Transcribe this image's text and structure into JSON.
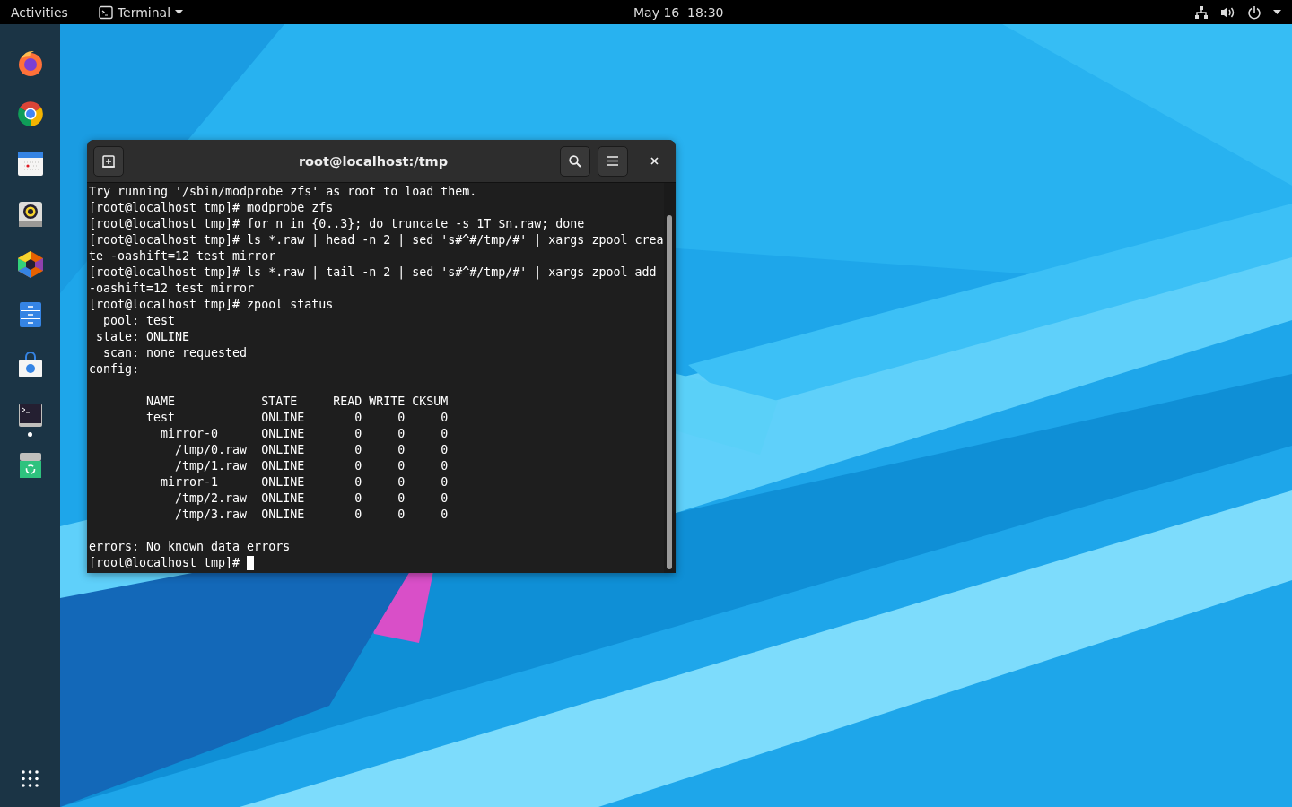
{
  "top_bar": {
    "activities": "Activities",
    "app_menu": "Terminal",
    "clock": "May 16  18:30"
  },
  "dock": {
    "items": [
      {
        "kind": "firefox",
        "running": false
      },
      {
        "kind": "chrome",
        "running": false
      },
      {
        "kind": "calendar",
        "running": false
      },
      {
        "kind": "rhythmbox",
        "running": false
      },
      {
        "kind": "photos",
        "running": false
      },
      {
        "kind": "files",
        "running": false
      },
      {
        "kind": "software",
        "running": false
      },
      {
        "kind": "terminal",
        "running": true
      },
      {
        "kind": "trash",
        "running": false
      }
    ]
  },
  "terminal_window": {
    "title": "root@localhost:/tmp",
    "cursor_visible": true,
    "blocks": [
      [
        "Try running '/sbin/modprobe zfs' as root to load them.",
        "[root@localhost tmp]# modprobe zfs",
        "[root@localhost tmp]# for n in {0..3}; do truncate -s 1T $n.raw; done",
        "[root@localhost tmp]# ls *.raw | head -n 2 | sed 's#^#/tmp/#' | xargs zpool crea",
        "te -oashift=12 test mirror",
        "[root@localhost tmp]# ls *.raw | tail -n 2 | sed 's#^#/tmp/#' | xargs zpool add",
        "-oashift=12 test mirror",
        "[root@localhost tmp]# zpool status",
        "  pool: test",
        " state: ONLINE",
        "  scan: none requested",
        "config:"
      ],
      [
        "\tNAME            STATE     READ WRITE CKSUM",
        "\ttest            ONLINE       0     0     0",
        "\t  mirror-0      ONLINE       0     0     0",
        "\t    /tmp/0.raw  ONLINE       0     0     0",
        "\t    /tmp/1.raw  ONLINE       0     0     0",
        "\t  mirror-1      ONLINE       0     0     0",
        "\t    /tmp/2.raw  ONLINE       0     0     0",
        "\t    /tmp/3.raw  ONLINE       0     0     0"
      ],
      [
        "errors: No known data errors",
        "[root@localhost tmp]# "
      ]
    ]
  }
}
